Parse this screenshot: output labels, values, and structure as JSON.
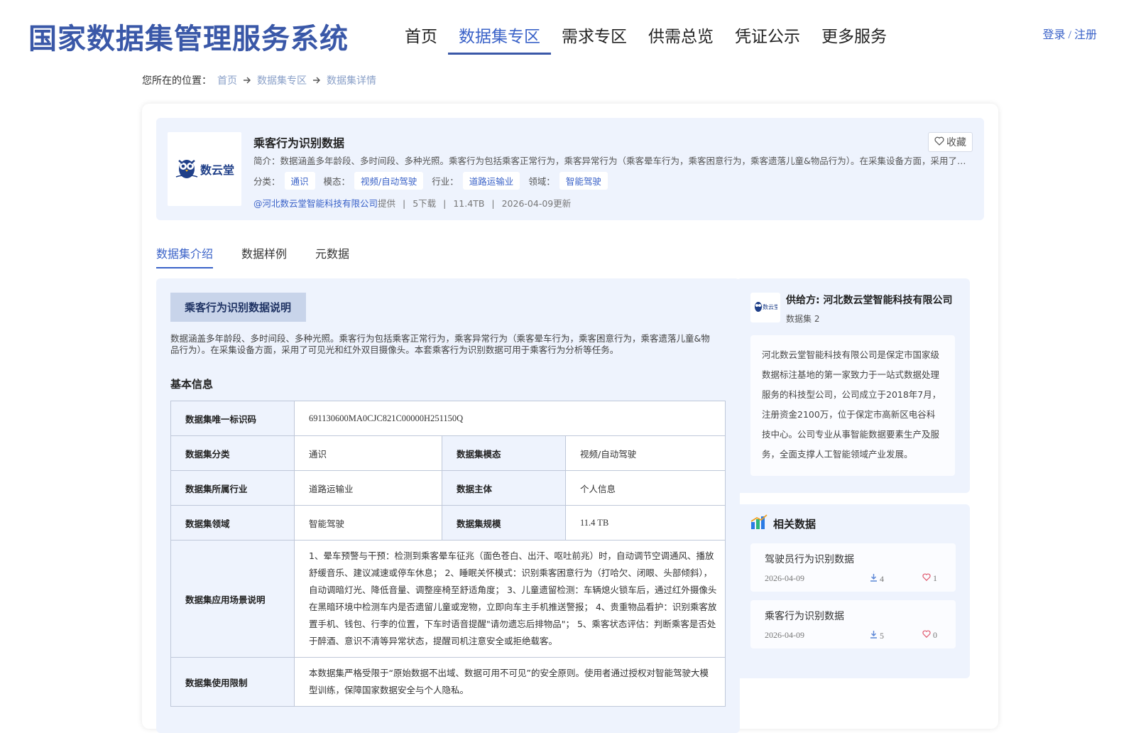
{
  "header": {
    "site_title": "国家数据集管理服务系统",
    "nav": [
      "首页",
      "数据集专区",
      "需求专区",
      "供需总览",
      "凭证公示",
      "更多服务"
    ],
    "active_nav": "数据集专区",
    "login": "登录 / 注册"
  },
  "breadcrumb": {
    "prefix": "您所在的位置：",
    "items": [
      "首页",
      "数据集专区",
      "数据集详情"
    ]
  },
  "dataset": {
    "logo_text": "数云堂",
    "title": "乘客行为识别数据",
    "summary": "简介：数据涵盖多年龄段、多时间段、多种光照。乘客行为包括乘客正常行为，乘客异常行为（乘客晕车行为，乘客困意行为，乘客遗落儿童&物品行为）。在采集设备方面，采用了可见光…",
    "tags": [
      {
        "label": "分类：",
        "value": "通识"
      },
      {
        "label": "模态：",
        "value": "视频/自动驾驶"
      },
      {
        "label": "行业：",
        "value": "道路运输业"
      },
      {
        "label": "领域：",
        "value": "智能驾驶"
      }
    ],
    "provider": "@河北数云堂智能科技有限公司",
    "provider_suffix": "提供",
    "downloads": "5下载",
    "size": "11.4TB",
    "updated": "2026-04-09更新",
    "separator": "|",
    "favorite_label": "收藏"
  },
  "tabs": [
    "数据集介绍",
    "数据样例",
    "元数据"
  ],
  "active_tab": "数据集介绍",
  "intro": {
    "heading": "乘客行为识别数据说明",
    "description": "数据涵盖多年龄段、多时间段、多种光照。乘客行为包括乘客正常行为，乘客异常行为（乘客晕车行为，乘客困意行为，乘客遗落儿童&物品行为）。在采集设备方面，采用了可见光和红外双目摄像头。本套乘客行为识别数据可用于乘客行为分析等任务。",
    "basic_title": "基本信息",
    "table": {
      "uid_label": "数据集唯一标识码",
      "uid_value": "691130600MA0CJC821C00000H251150Q",
      "category_label": "数据集分类",
      "category_value": "通识",
      "modality_label": "数据集模态",
      "modality_value": "视频/自动驾驶",
      "industry_label": "数据集所属行业",
      "industry_value": "道路运输业",
      "subject_label": "数据主体",
      "subject_value": "个人信息",
      "field_label": "数据集领域",
      "field_value": "智能驾驶",
      "scale_label": "数据集规模",
      "scale_value": "11.4 TB",
      "scenario_label": "数据集应用场景说明",
      "scenario_value": "1、晕车预警与干预：检测到乘客晕车征兆（面色苍白、出汗、呕吐前兆）时，自动调节空调通风、播放舒缓音乐、建议减速或停车休息； 2、睡眠关怀模式：识别乘客困意行为（打哈欠、闭眼、头部倾斜），自动调暗灯光、降低音量、调整座椅至舒适角度； 3、儿童遗留检测：车辆熄火锁车后，通过红外摄像头在黑暗环境中检测车内是否遗留儿童或宠物，立即向车主手机推送警报； 4、贵重物品看护：识别乘客放置手机、钱包、行李的位置，下车时语音提醒\"请勿遗忘后排物品\"； 5、乘客状态评估：判断乘客是否处于醉酒、意识不清等异常状态，提醒司机注意安全或拒绝载客。",
      "limit_label": "数据集使用限制",
      "limit_value": "本数据集严格受限于“原始数据不出域、数据可用不可见”的安全原则。使用者通过授权对智能驾驶大模型训练，保障国家数据安全与个人隐私。"
    }
  },
  "supplier": {
    "logo_text": "数云堂",
    "name": "供给方: 河北数云堂智能科技有限公司",
    "count": "数据集 2",
    "description": "河北数云堂智能科技有限公司是保定市国家级数据标注基地的第一家致力于一站式数据处理服务的科技型公司，公司成立于2018年7月，注册资金2100万，位于保定市高新区电谷科技中心。公司专业从事智能数据要素生产及服务，全面支撑人工智能领域产业发展。"
  },
  "related": {
    "title": "相关数据",
    "items": [
      {
        "title": "驾驶员行为识别数据",
        "date": "2026-04-09",
        "downloads": "4",
        "likes": "1"
      },
      {
        "title": "乘客行为识别数据",
        "date": "2026-04-09",
        "downloads": "5",
        "likes": "0"
      }
    ]
  },
  "colors": {
    "brand_blue": "#3a58a8",
    "link_blue": "#3a62c8",
    "panel_bg": "#eef3fd",
    "like_red": "#e0566b"
  },
  "icons": [
    "owl-logo-icon",
    "heart-icon",
    "arrow-right-icon",
    "bar-chart-icon",
    "download-icon"
  ]
}
